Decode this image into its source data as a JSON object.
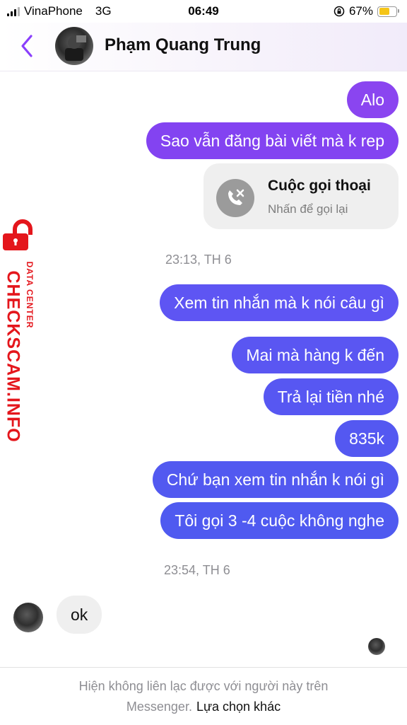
{
  "status_bar": {
    "carrier": "VinaPhone",
    "network": "3G",
    "time": "06:49",
    "battery": "67%",
    "battery_level": 0.67,
    "battery_color": "#f5c518"
  },
  "header": {
    "back_icon": "chevron-left-icon",
    "contact_name": "Phạm Quang Trung",
    "accent": "#8a3ffc"
  },
  "messages": {
    "m1": "Alo",
    "m2": "Sao vẫn đăng bài viết mà k rep",
    "call": {
      "title": "Cuộc gọi thoại",
      "subtitle": "Nhấn để gọi lại",
      "icon": "missed-call-icon"
    },
    "ts1": "23:13, TH 6",
    "m3": "Xem tin nhắn mà k nói câu gì",
    "m4": "Mai mà hàng k đến",
    "m5": "Trả lại tiền nhé",
    "m6": "835k",
    "m7": "Chứ bạn xem tin nhắn k nói gì",
    "m8": "Tôi gọi 3 -4 cuộc không nghe",
    "ts2": "23:54, TH 6",
    "reply": "ok"
  },
  "bubble_colors": [
    "#8a45f0",
    "#7d4cf2",
    "#6650f3",
    "#5b56f2",
    "#5058f0"
  ],
  "watermark": {
    "brand": "CHECKSCAM.INFO",
    "tagline": "DATA CENTER",
    "color": "#e4161c"
  },
  "footer": {
    "notice_line1": "Hiện không liên lạc được với người này trên",
    "notice_line2": "Messenger.",
    "link": "Lựa chọn khác"
  }
}
